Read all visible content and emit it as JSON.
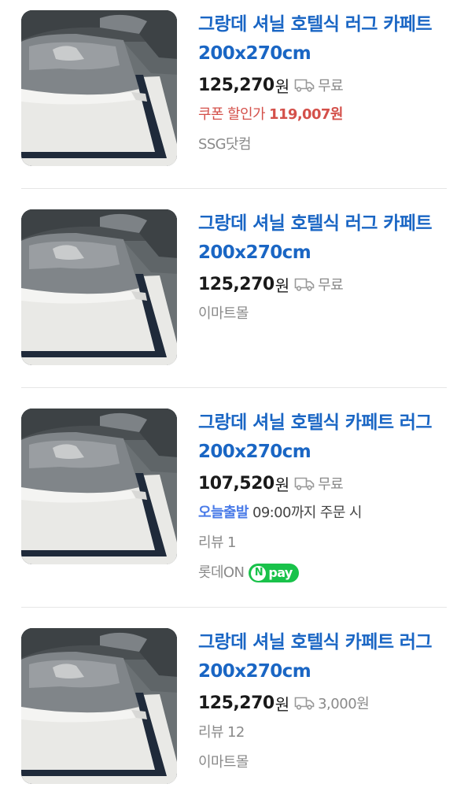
{
  "products": [
    {
      "title": "그랑데 셔닐 호텔식 러그 카페트 200x270cm",
      "price": "125,270",
      "currency": "원",
      "shipping": "무료",
      "coupon_label": "쿠폰 할인가",
      "coupon_price": "119,007원",
      "seller": "SSG닷컴",
      "thumb_icon": "bed-rug-photo"
    },
    {
      "title": "그랑데 셔닐 호텔식 러그 카페트 200x270cm",
      "price": "125,270",
      "currency": "원",
      "shipping": "무료",
      "seller": "이마트몰",
      "thumb_icon": "bed-rug-photo"
    },
    {
      "title": "그랑데 셔닐 호텔식 카페트 러그 200x270cm",
      "price": "107,520",
      "currency": "원",
      "shipping": "무료",
      "fast_label": "오늘출발",
      "fast_text": "09:00까지 주문 시",
      "review": "리뷰 1",
      "seller": "롯데ON",
      "npay_label": "pay",
      "npay_n": "N",
      "thumb_icon": "bed-rug-photo"
    },
    {
      "title": "그랑데 셔닐 호텔식 카페트 러그 200x270cm",
      "price": "125,270",
      "currency": "원",
      "shipping": "3,000원",
      "review": "리뷰 12",
      "seller": "이마트몰",
      "thumb_icon": "bed-rug-photo"
    }
  ],
  "colors": {
    "title": "#1a66c4",
    "coupon": "#d4504a",
    "fast_delivery": "#4a7be8",
    "npay": "#19c24a",
    "meta_gray": "#8a8a8a"
  }
}
